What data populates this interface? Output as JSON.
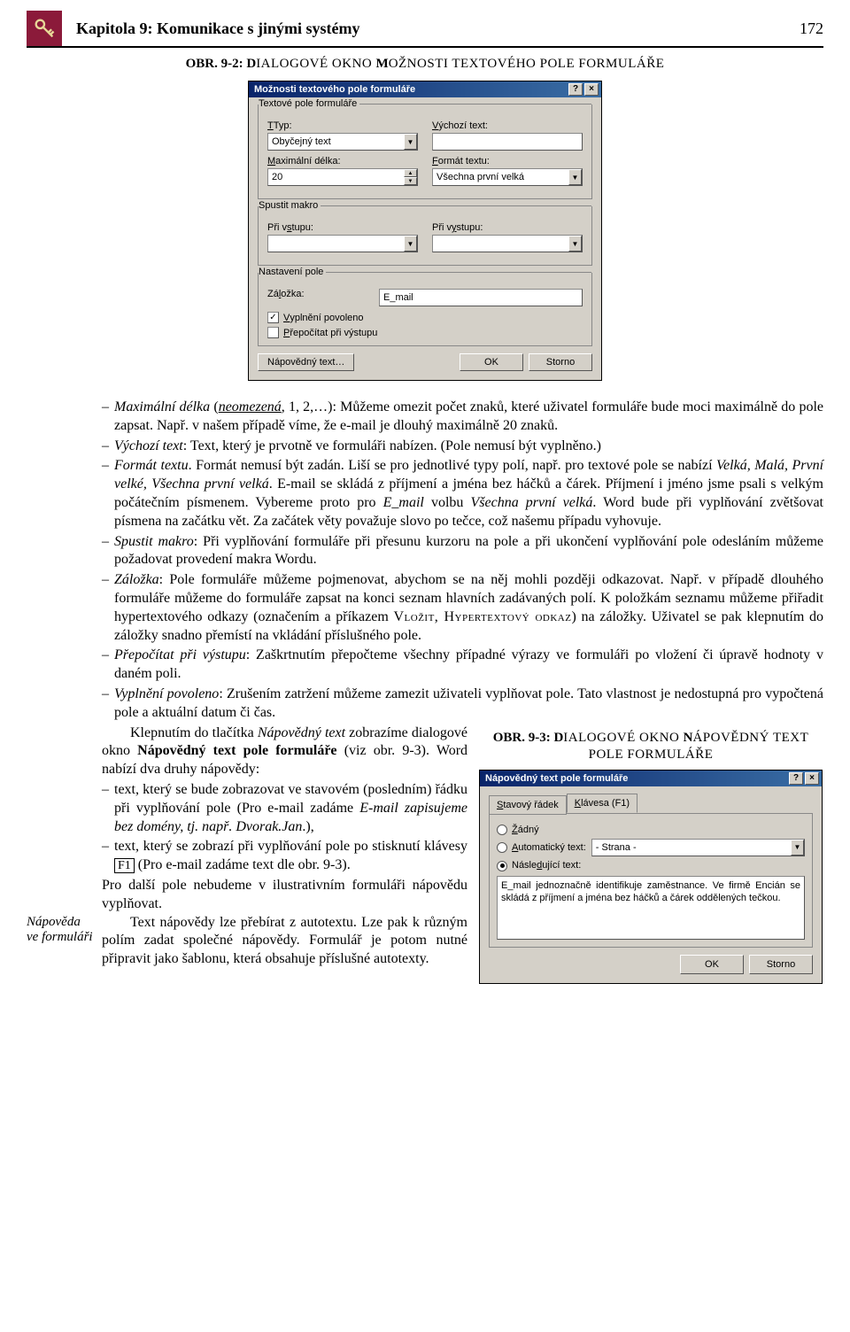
{
  "header": {
    "chapter": "Kapitola 9: Komunikace s jinými systémy",
    "page": "172"
  },
  "fig1": {
    "obr": "OBR. 9-2: D",
    "rest": "IALOGOVÉ OKNO ",
    "m": "M",
    "rest2": "OŽNOSTI TEXTOVÉHO POLE FORMULÁŘE"
  },
  "dlg1": {
    "title": "Možnosti textového pole formuláře",
    "help": "?",
    "close": "×",
    "grp1": "Textové pole formuláře",
    "typ": {
      "lbl": "Typ:",
      "u": "T",
      "val": "Obyčejný text"
    },
    "vychozi": {
      "lbl": "ýchozí text:",
      "u": "V",
      "val": ""
    },
    "maxd": {
      "lbl": "aximální délka:",
      "u": "M",
      "val": "20"
    },
    "fmt": {
      "lbl": "ormát textu:",
      "u": "F",
      "val": "Všechna první velká"
    },
    "grp2": "Spustit makro",
    "vstup": {
      "lbl": "Při vstupu:",
      "u": "s",
      "val": ""
    },
    "vystup": {
      "lbl": "Při výstupu:",
      "u": "y",
      "val": ""
    },
    "grp3": "Nastavení pole",
    "zalozka": {
      "lbl": "Záložka:",
      "u": "l",
      "val": "E_mail"
    },
    "cb1": {
      "lbl": "yplnění povoleno",
      "u": "V",
      "checked": true
    },
    "cb2": {
      "lbl": "řepočítat při výstupu",
      "u": "P",
      "checked": false
    },
    "btn_help": "Nápovědný text…",
    "btn_ok": "OK",
    "btn_storno": "Storno"
  },
  "margin": "Nápověda ve formuláři",
  "body": {
    "b1a": "Maximální délka",
    "b1b": " (",
    "b1c": "neomezená",
    "b1d": ", 1, 2,…): Můžeme omezit počet znaků, které uživatel formuláře bude moci maximálně do pole zapsat. Např. v našem případě víme, že e-mail je dlouhý maximálně 20 znaků.",
    "b2a": "Výchozí text",
    "b2b": ": Text, který je prvotně ve formuláři nabízen. (Pole nemusí být vyplněno.)",
    "b3a": "Formát textu",
    "b3b": ". Formát nemusí být zadán. Liší se pro jednotlivé typy polí, např. pro textové pole se nabízí ",
    "b3c": "Velká, Malá, První velké, Všechna první velká",
    "b3d": ". E-mail se skládá z příjmení a jména bez háčků a čárek. Příjmení i jméno jsme psali s velkým počátečním písmenem. Vybereme proto pro ",
    "b3e": "E_mail",
    "b3f": " volbu ",
    "b3g": "Všechna první velká",
    "b3h": ". Word bude při vyplňování zvětšovat písmena na začátku vět. Za začátek věty považuje slovo po tečce, což našemu případu vyhovuje.",
    "b4a": "Spustit makro",
    "b4b": ": Při vyplňování formuláře při přesunu kurzoru na pole a při ukončení vyplňování pole odesláním můžeme požadovat provedení makra Wordu.",
    "b5a": "Záložka",
    "b5b": ": Pole formuláře můžeme pojmenovat, abychom se na něj mohli později odkazovat. Např. v případě dlouhého formuláře můžeme do formuláře zapsat na konci seznam hlavních zadávaných polí. K položkám seznamu můžeme přiřadit hypertextového odkazy (označením a příkazem ",
    "b5c": "Vložit, Hypertextový odkaz",
    "b5d": ") na záložky. Uživatel se pak klepnutím do záložky snadno přemístí na vkládání příslušného pole.",
    "b6a": "Přepočítat při výstupu",
    "b6b": ": Zaškrtnutím přepočteme všechny případné výrazy ve formuláři po vložení či úpravě hodnoty v daném poli.",
    "b7a": "Vyplnění povoleno",
    "b7b": ": Zrušením zatržení můžeme zamezit uživateli vyplňovat pole. Tato vlastnost je nedostupná pro vypočtená pole a aktuální datum či čas.",
    "p1a": "Klepnutím do tlačítka ",
    "p1b": "Nápovědný text",
    "p1c": " zobrazíme dialogové okno ",
    "p1d": "Nápovědný text pole formuláře",
    "p1e": " (viz obr. 9-3). Word nabízí dva druhy nápovědy:",
    "pb1a": "text, který se bude zobrazovat ve stavovém (posledním) řádku při vyplňování pole (Pro e-mail zadáme ",
    "pb1b": "E-mail zapisujeme bez domény, tj. např. Dvorak.Jan",
    "pb1c": ".),",
    "pb2a": "text, který se zobrazí při vyplňování pole po stisknutí klávesy ",
    "pb2b": "F1",
    "pb2c": " (Pro e-mail zadáme text dle obr. 9-3).",
    "p2": "Pro další pole nebudeme v ilustrativním formuláři nápovědu vyplňovat.",
    "p3": "Text nápovědy lze přebírat z autotextu. Lze pak k různým polím zadat společné nápovědy. Formulář je potom nutné připravit jako šablonu, která obsahuje příslušné autotexty."
  },
  "fig2": {
    "obr": "OBR. 9-3: D",
    "rest": "IALOGOVÉ OKNO ",
    "n": "N",
    "rest2": "ÁPOVĚDNÝ TEXT POLE FORMULÁŘE"
  },
  "dlg2": {
    "title": "Nápovědný text pole formuláře",
    "tab1": {
      "lbl": "tavový řádek",
      "u": "S"
    },
    "tab2": {
      "lbl": "lávesa (F1)",
      "u": "K"
    },
    "r1": {
      "lbl": "ádný",
      "u": "Ž"
    },
    "r2": {
      "lbl": "utomatický text:",
      "u": "A",
      "val": "- Strana -"
    },
    "r3": {
      "lbl": "Násle",
      "u": "d",
      "lbl2": "ující text:"
    },
    "ta": "E_mail jednoznačně identifikuje zaměstnance. Ve firmě Encián se skládá z příjmení a jména bez háčků a čárek oddělených tečkou.",
    "btn_ok": "OK",
    "btn_storno": "Storno"
  }
}
